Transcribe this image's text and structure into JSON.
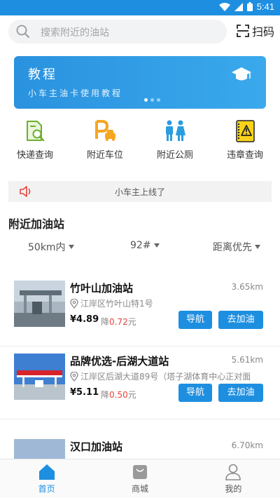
{
  "status_bar": {
    "time": "5:41"
  },
  "search": {
    "placeholder": "搜索附近的油站",
    "scan_label": "扫码"
  },
  "banner": {
    "title": "教程",
    "subtitle": "小车主油卡使用教程"
  },
  "quick_links": [
    {
      "label": "快递查询",
      "icon": "package-search-icon"
    },
    {
      "label": "附近车位",
      "icon": "parking-icon"
    },
    {
      "label": "附近公厕",
      "icon": "restroom-icon"
    },
    {
      "label": "违章查询",
      "icon": "warning-notebook-icon"
    }
  ],
  "notice": {
    "text": "小车主上线了"
  },
  "section": {
    "title": "附近加油站"
  },
  "filters": {
    "distance": "50km内",
    "fuel": "92#",
    "sort": "距离优先"
  },
  "stations": [
    {
      "name": "竹叶山加油站",
      "distance": "3.65km",
      "address": "江岸区竹叶山特1号",
      "price": "¥4.89",
      "drop_label": "降",
      "drop_amount": "0.72",
      "drop_unit": "元",
      "nav_label": "导航",
      "fuel_label": "去加油"
    },
    {
      "name": "品牌优选-后湖大道站",
      "distance": "5.61km",
      "address": "江岸区后湖大道89号（塔子湖体育中心正对面",
      "price": "¥5.11",
      "drop_label": "降",
      "drop_amount": "0.50",
      "drop_unit": "元",
      "nav_label": "导航",
      "fuel_label": "去加油"
    },
    {
      "name": "汉口加油站",
      "distance": "6.70km",
      "address": "",
      "price": "",
      "drop_label": "",
      "drop_amount": "",
      "drop_unit": "",
      "nav_label": "",
      "fuel_label": ""
    }
  ],
  "tabs": [
    {
      "label": "首页",
      "active": true
    },
    {
      "label": "商城",
      "active": false
    },
    {
      "label": "我的",
      "active": false
    }
  ],
  "colors": {
    "brand_blue": "#1e8fe0",
    "discount_red": "#e8413b"
  }
}
